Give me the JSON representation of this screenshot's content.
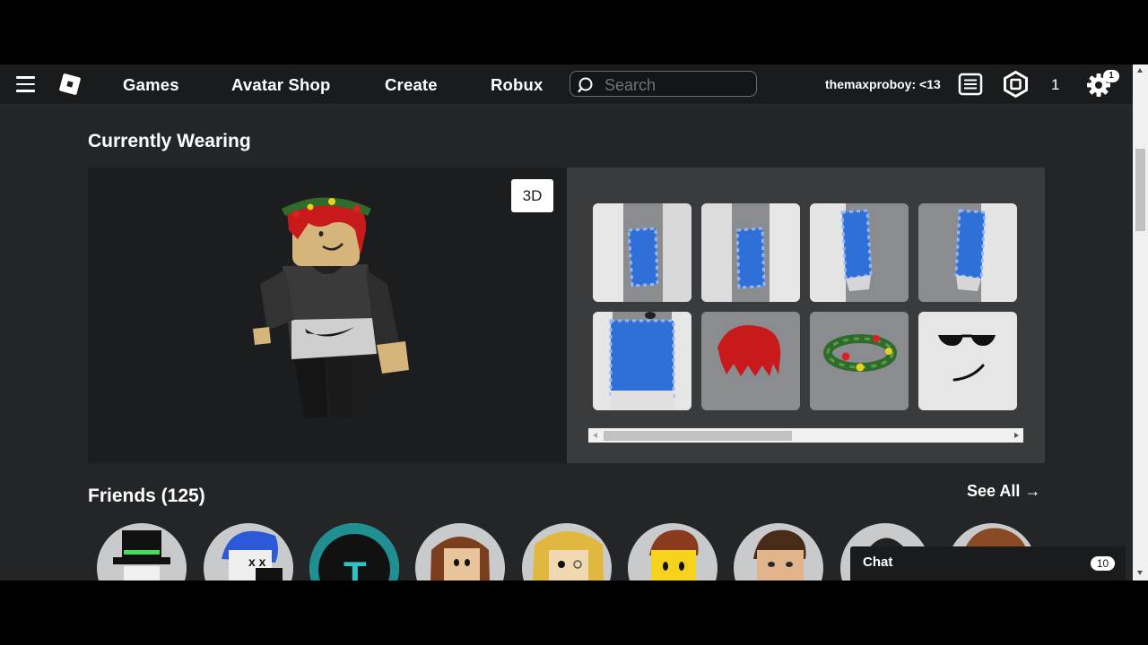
{
  "nav": {
    "links": [
      "Games",
      "Avatar Shop",
      "Create",
      "Robux"
    ],
    "search_placeholder": "Search",
    "username": "themaxproboy: <13",
    "robux_count": "1",
    "settings_badge": "1"
  },
  "wearing": {
    "title": "Currently Wearing",
    "toggle_3d_label": "3D",
    "items": [
      "left-arm-shirt",
      "right-arm-shirt",
      "left-sleeve",
      "right-sleeve",
      "torso-shirt",
      "red-hair",
      "holly-wreath-crown",
      "sunglasses-smile-face"
    ],
    "items_scroll_fraction": 0.45
  },
  "friends": {
    "title": "Friends (125)",
    "see_all_label": "See All",
    "avatars": [
      "friend-1",
      "friend-2",
      "friend-3",
      "friend-4",
      "friend-5",
      "friend-6",
      "friend-7",
      "friend-8",
      "friend-9"
    ]
  },
  "chat": {
    "label": "Chat",
    "unread_count": "10"
  },
  "colors": {
    "page_bg": "#232527",
    "nav_bg": "#191b1d",
    "panel_bg": "#393b3d",
    "avatar_panel_bg": "#1b1d1f"
  }
}
